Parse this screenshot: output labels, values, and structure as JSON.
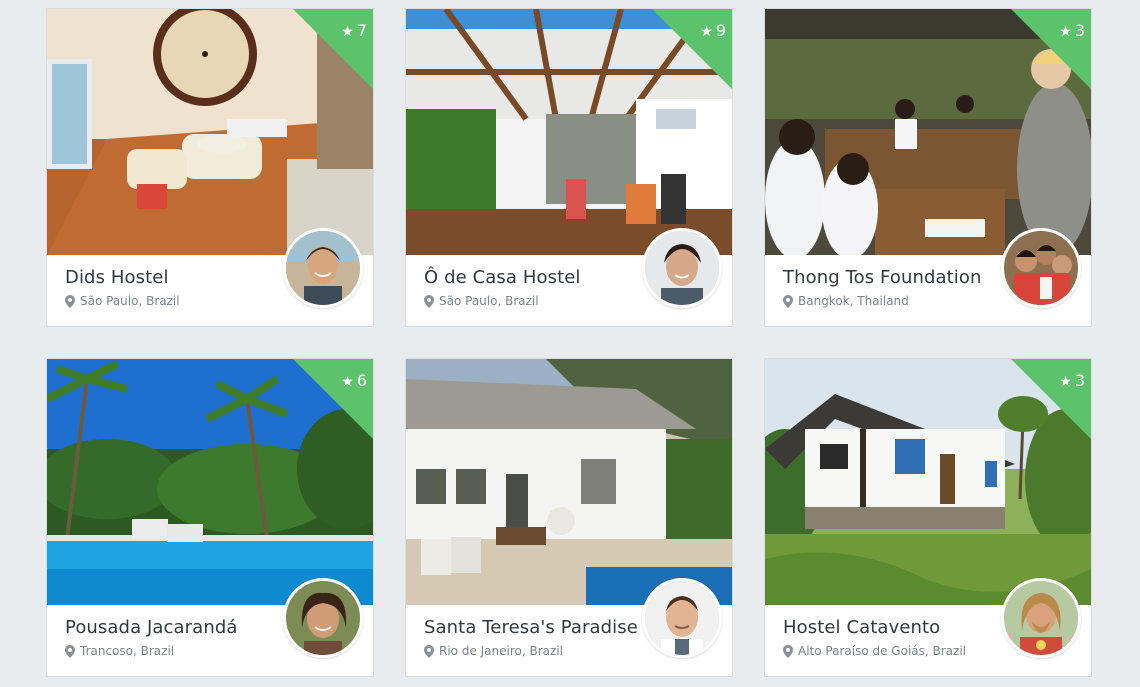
{
  "listings": [
    {
      "name": "Dids Hostel",
      "location": "São Paulo, Brazil",
      "rating": "7",
      "accent": "#5cc26b"
    },
    {
      "name": "Ô de Casa Hostel",
      "location": "São Paulo, Brazil",
      "rating": "9",
      "accent": "#5cc26b"
    },
    {
      "name": "Thong Tos Foundation",
      "location": "Bangkok, Thailand",
      "rating": "3",
      "accent": "#5cc26b"
    },
    {
      "name": "Pousada Jacarandá",
      "location": "Trancoso, Brazil",
      "rating": "6",
      "accent": "#5cc26b"
    },
    {
      "name": "Santa Teresa's Paradise",
      "location": "Rio de Janeiro, Brazil",
      "rating": "",
      "accent": "#5cc26b"
    },
    {
      "name": "Hostel Catavento",
      "location": "Alto Paraíso de Goiás, Brazil",
      "rating": "3",
      "accent": "#5cc26b"
    }
  ],
  "icons": {
    "rating": "star-icon",
    "location": "map-pin-icon"
  }
}
